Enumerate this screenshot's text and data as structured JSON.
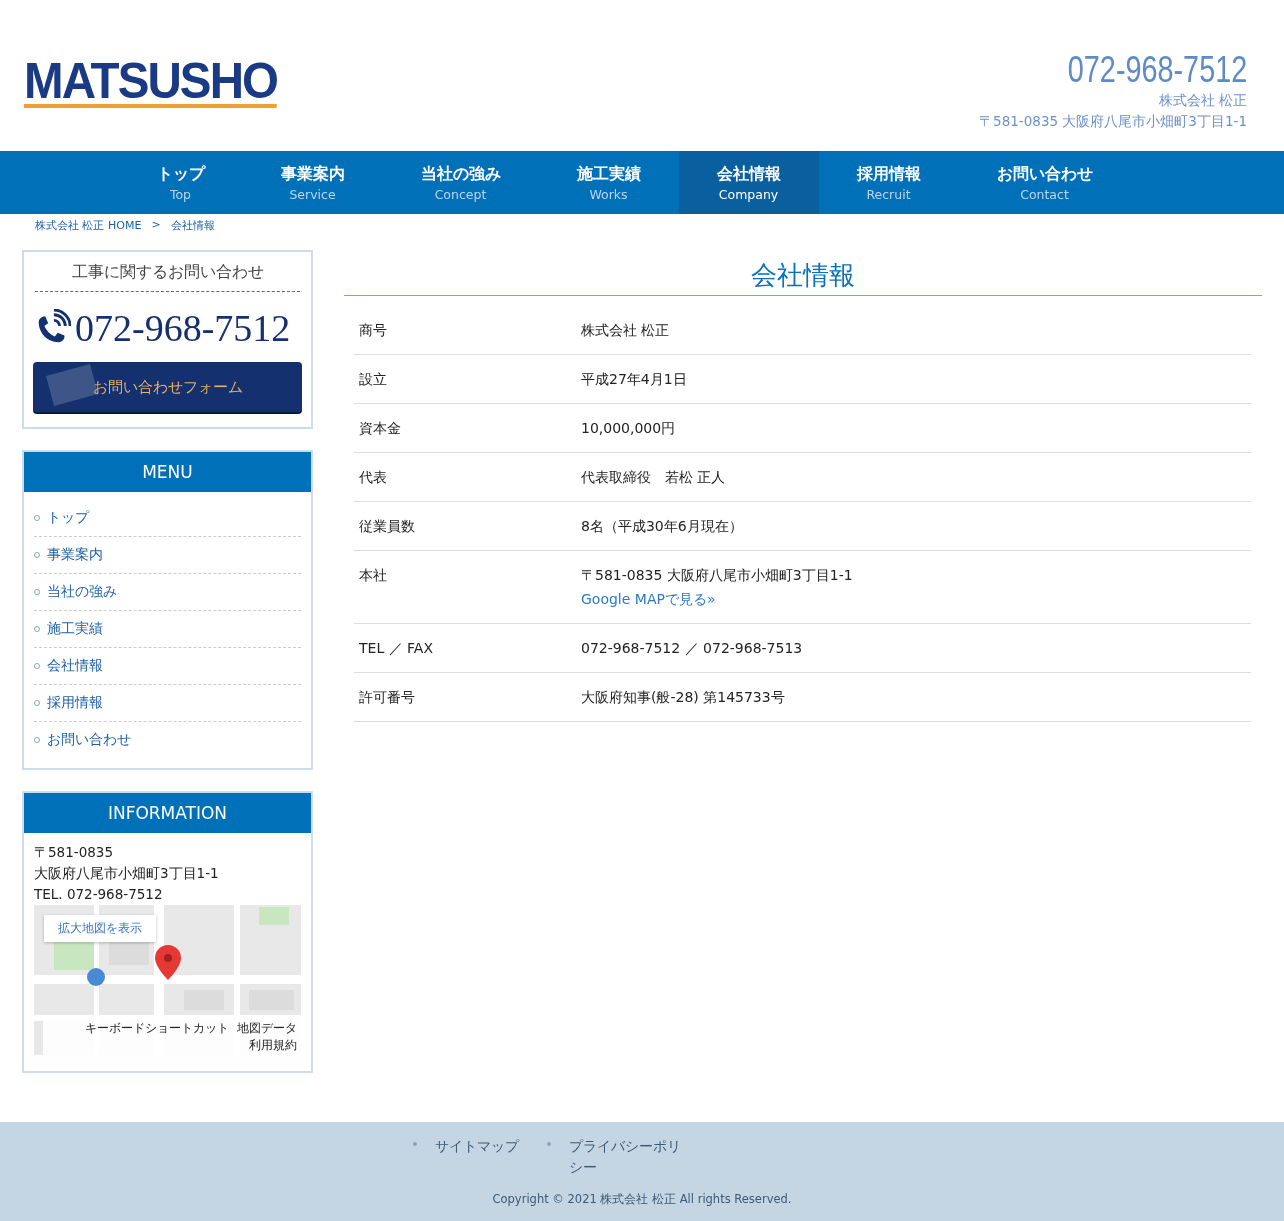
{
  "header": {
    "logo": "MATSUSHO",
    "phone": "072-968-7512",
    "company": "株式会社 松正",
    "address": "〒581-0835 大阪府八尾市小畑町3丁目1-1"
  },
  "nav": [
    {
      "label": "トップ",
      "sub": "Top",
      "selected": false
    },
    {
      "label": "事業案内",
      "sub": "Service",
      "selected": false
    },
    {
      "label": "当社の強み",
      "sub": "Concept",
      "selected": false
    },
    {
      "label": "施工実績",
      "sub": "Works",
      "selected": false
    },
    {
      "label": "会社情報",
      "sub": "Company",
      "selected": true
    },
    {
      "label": "採用情報",
      "sub": "Recruit",
      "selected": false
    },
    {
      "label": "お問い合わせ",
      "sub": "Contact",
      "selected": false
    }
  ],
  "breadcrumb": [
    "株式会社 松正 HOME",
    ">",
    "会社情報"
  ],
  "contact_box": {
    "title": "工事に関するお問い合わせ",
    "phone": "072-968-7512",
    "button": "お問い合わせフォーム"
  },
  "menu": {
    "title": "MENU",
    "items": [
      "トップ",
      "事業案内",
      "当社の強み",
      "施工実績",
      "会社情報",
      "採用情報",
      "お問い合わせ"
    ]
  },
  "information": {
    "title": "INFORMATION",
    "lines": [
      "〒581-0835",
      "大阪府八尾市小畑町3丁目1-1",
      "TEL. 072-968-7512"
    ],
    "map": {
      "kind": "picture",
      "button": "拡大地図を表示",
      "attribution": [
        "キーボードショートカット",
        "地図データ",
        "利用規約"
      ]
    }
  },
  "page_title": "会社情報",
  "table": {
    "rows": [
      {
        "label": "商号",
        "value": "株式会社 松正"
      },
      {
        "label": "設立",
        "value": "平成27年4月1日"
      },
      {
        "label": "資本金",
        "value": "10,000,000円"
      },
      {
        "label": "代表",
        "value": "代表取締役　若松 正人"
      },
      {
        "label": "従業員数",
        "value": "8名（平成30年6月現在）"
      },
      {
        "label": "本社",
        "value": "〒581-0835 大阪府八尾市小畑町3丁目1-1",
        "link": "Google MAPで見る»"
      },
      {
        "label": "TEL ／ FAX",
        "value": "072-968-7512 ／ 072-968-7513"
      },
      {
        "label": "許可番号",
        "value": "大阪府知事(般-28) 第145733号"
      }
    ]
  },
  "footer": {
    "links": [
      "サイトマップ",
      "プライバシーポリシー"
    ],
    "copyright": "Copyright © 2021 株式会社 松正 All rights Reserved."
  }
}
